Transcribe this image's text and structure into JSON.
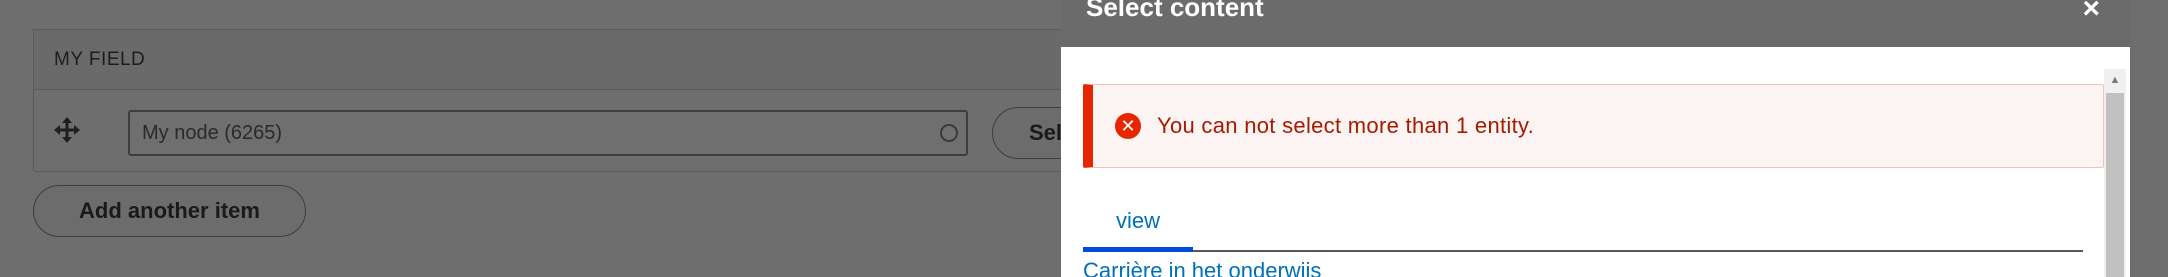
{
  "background": {
    "field_label": "MY FIELD",
    "autocomplete_value": "My node (6265)",
    "select_button_label": "Sel",
    "add_another_label": "Add another item"
  },
  "dialog": {
    "title": "Select content",
    "close_glyph": "×",
    "error": {
      "icon_glyph": "✕",
      "message": "You can not select more than 1 entity."
    },
    "tabs": [
      {
        "label": "view"
      }
    ],
    "results": [
      {
        "label": "Carrière in het onderwijs"
      }
    ]
  },
  "colors": {
    "error_red": "#e62600",
    "link_blue": "#0071b8",
    "active_tab": "#004adc",
    "overlay": "#6b6b6b"
  }
}
